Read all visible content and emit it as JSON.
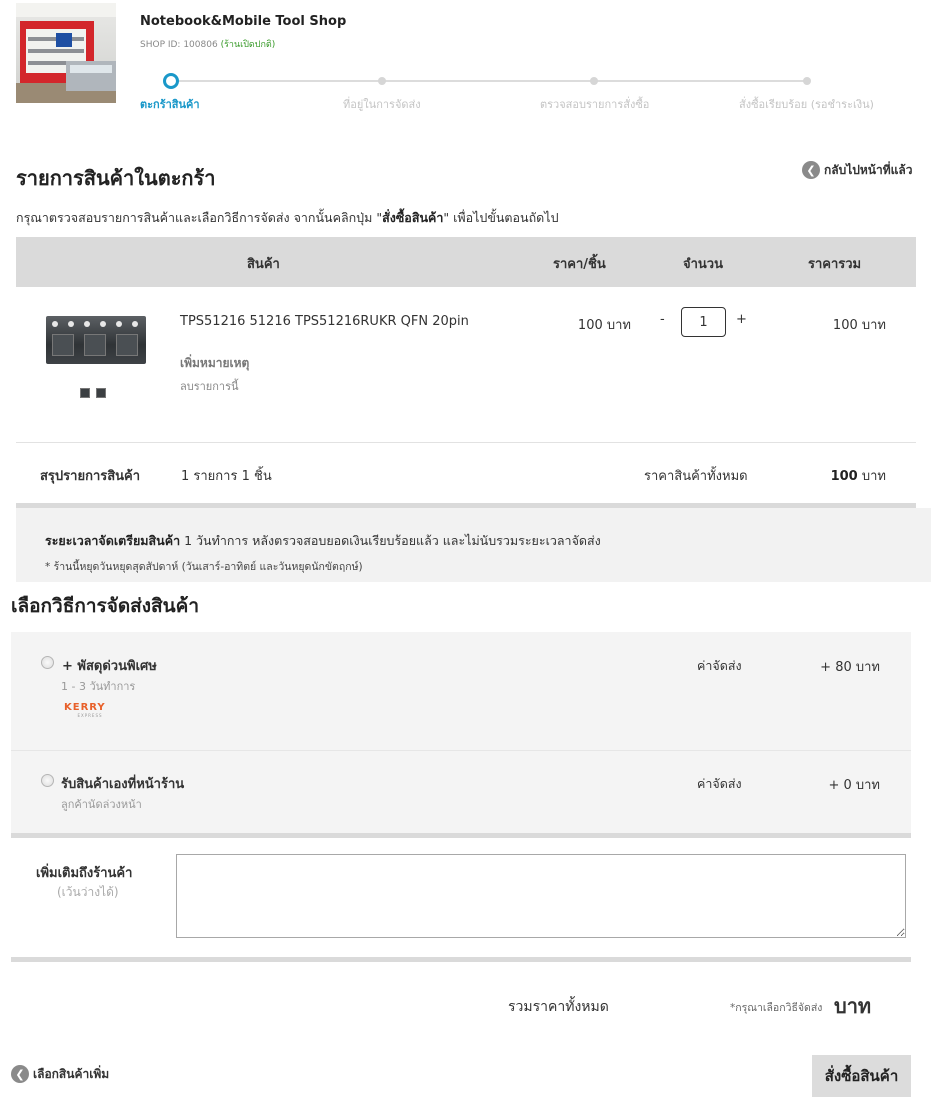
{
  "shop": {
    "name": "Notebook&Mobile Tool Shop",
    "id_label": "SHOP ID: 100806",
    "status": "(ร้านเปิดปกติ)"
  },
  "steps": [
    {
      "label": "ตะกร้าสินค้า",
      "active": true
    },
    {
      "label": "ที่อยู่ในการจัดส่ง",
      "active": false
    },
    {
      "label": "ตรวจสอบรายการสั่งซื้อ",
      "active": false
    },
    {
      "label": "สั่งซื้อเรียบร้อย (รอชำระเงิน)",
      "active": false
    }
  ],
  "cart": {
    "title": "รายการสินค้าในตะกร้า",
    "back_link": "กลับไปหน้าที่แล้ว",
    "instruction_pre": "กรุณาตรวจสอบรายการสินค้าและเลือกวิธีการจัดส่ง จากนั้นคลิกปุ่ม \"",
    "instruction_bold": "สั่งซื้อสินค้า",
    "instruction_post": "\" เพื่อไปขั้นตอนถัดไป",
    "columns": {
      "product": "สินค้า",
      "unit_price": "ราคา/ชิ้น",
      "quantity": "จำนวน",
      "total": "ราคารวม"
    },
    "items": [
      {
        "name": "TPS51216 51216 TPS51216RUKR QFN 20pin",
        "add_note": "เพิ่มหมายเหตุ",
        "remove": "ลบรายการนี้",
        "unit_price": "100 บาท",
        "quantity": "1",
        "minus": "-",
        "plus": "+",
        "total": "100 บาท"
      }
    ],
    "summary": {
      "label": "สรุปรายการสินค้า",
      "count": "1 รายการ 1 ชิ้น",
      "all_label": "ราคาสินค้าทั้งหมด",
      "all_value": "100",
      "currency": "บาท"
    },
    "prep": {
      "bold": "ระยะเวลาจัดเตรียมสินค้า",
      "text": " 1 วันทำการ หลังตรวจสอบยอดเงินเรียบร้อยแล้ว และไม่นับรวมระยะเวลาจัดส่ง",
      "note": "* ร้านนี้หยุดวันหยุดสุดสัปดาห์ (วันเสาร์-อาทิตย์ และวันหยุดนักขัตฤกษ์)"
    }
  },
  "shipping": {
    "title": "เลือกวิธีการจัดส่งสินค้า",
    "options": [
      {
        "name": "+ พัสดุด่วนพิเศษ",
        "sub": "1 - 3 วันทำการ",
        "fee_label": "ค่าจัดส่ง",
        "fee": "+ 80 บาท",
        "logo_text": "KERRY",
        "logo_sub": "EXPRESS"
      },
      {
        "name": "รับสินค้าเองที่หน้าร้าน",
        "sub": "ลูกค้านัดล่วงหน้า",
        "fee_label": "ค่าจัดส่ง",
        "fee": "+ 0 บาท"
      }
    ]
  },
  "note": {
    "label": "เพิ่มเติมถึงร้านค้า",
    "optional": "(เว้นว่างได้)",
    "value": ""
  },
  "totals": {
    "label": "รวมราคาทั้งหมด",
    "hint": "*กรุณาเลือกวิธีจัดส่ง",
    "unit": "บาท"
  },
  "footer": {
    "more_link": "เลือกสินค้าเพิ่ม",
    "order_button": "สั่งซื้อสินค้า"
  },
  "colors": {
    "accent": "#1a98c9",
    "open_status": "#3a9b2b",
    "kerry": "#e8602a"
  },
  "icons": {
    "back": "chevron-left-icon",
    "more": "chevron-left-icon"
  }
}
